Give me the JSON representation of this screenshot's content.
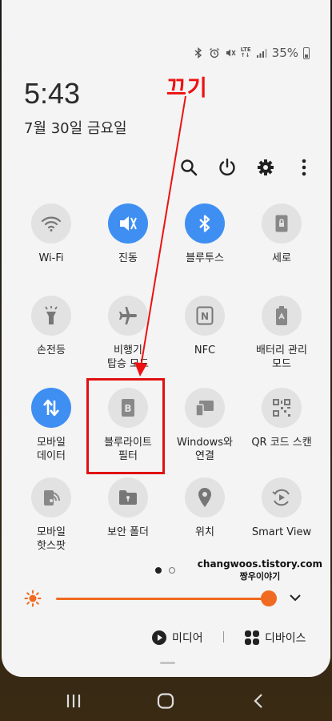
{
  "status_bar": {
    "battery": "35%",
    "network": "LTE"
  },
  "clock": {
    "time": "5:43",
    "date": "7월 30일 금요일"
  },
  "annotation": {
    "text": "끄기",
    "color": "#ee1111"
  },
  "header_actions": [
    {
      "name": "search-icon"
    },
    {
      "name": "power-icon"
    },
    {
      "name": "settings-icon"
    },
    {
      "name": "more-icon"
    }
  ],
  "tiles": [
    {
      "label": "Wi-Fi",
      "icon": "wifi-icon",
      "active": false
    },
    {
      "label": "진동",
      "icon": "vibrate-icon",
      "active": true
    },
    {
      "label": "블루투스",
      "icon": "bluetooth-icon",
      "active": true
    },
    {
      "label": "세로",
      "icon": "portrait-lock-icon",
      "active": false
    },
    {
      "label": "손전등",
      "icon": "flashlight-icon",
      "active": false
    },
    {
      "label": "비행기\n탑승 모드",
      "icon": "airplane-icon",
      "active": false
    },
    {
      "label": "NFC",
      "icon": "nfc-icon",
      "active": false
    },
    {
      "label": "배터리 관리\n모드",
      "icon": "battery-saver-icon",
      "active": false
    },
    {
      "label": "모바일\n데이터",
      "icon": "mobile-data-icon",
      "active": true
    },
    {
      "label": "블루라이트\n필터",
      "icon": "blue-light-filter-icon",
      "active": false
    },
    {
      "label": "Windows와\n연결",
      "icon": "link-windows-icon",
      "active": false
    },
    {
      "label": "QR 코드 스캔",
      "icon": "qr-code-icon",
      "active": false
    },
    {
      "label": "모바일\n핫스팟",
      "icon": "hotspot-icon",
      "active": false
    },
    {
      "label": "보안 폴더",
      "icon": "secure-folder-icon",
      "active": false
    },
    {
      "label": "위치",
      "icon": "location-icon",
      "active": false
    },
    {
      "label": "Smart View",
      "icon": "smart-view-icon",
      "active": false
    }
  ],
  "watermark": {
    "line1": "changwoos.tistory.com",
    "line2": "짱우이야기"
  },
  "brightness": {
    "level": 0.97,
    "color": "#f06a1f"
  },
  "media": {
    "label": "미디어"
  },
  "devices": {
    "label": "디바이스"
  },
  "page_indicator": {
    "current": 1,
    "total": 2
  },
  "navigation": [
    "recent-apps-button",
    "home-button",
    "back-button"
  ]
}
